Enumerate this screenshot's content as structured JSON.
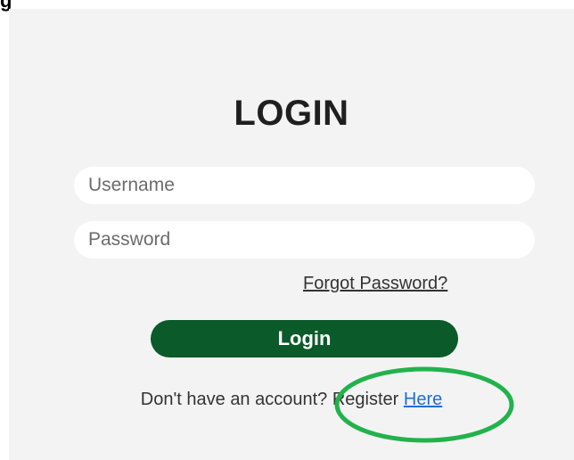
{
  "top_fragment": "g",
  "login": {
    "title": "LOGIN",
    "username_placeholder": "Username",
    "password_placeholder": "Password",
    "forgot_label": "Forgot Password?",
    "submit_label": "Login",
    "register_prompt": "Don't have an account? Register ",
    "register_link": "Here"
  },
  "colors": {
    "panel_bg": "#f3f3f3",
    "button_bg": "#0b5a2a",
    "link": "#1e6fd9",
    "annotation": "#22b24c"
  }
}
